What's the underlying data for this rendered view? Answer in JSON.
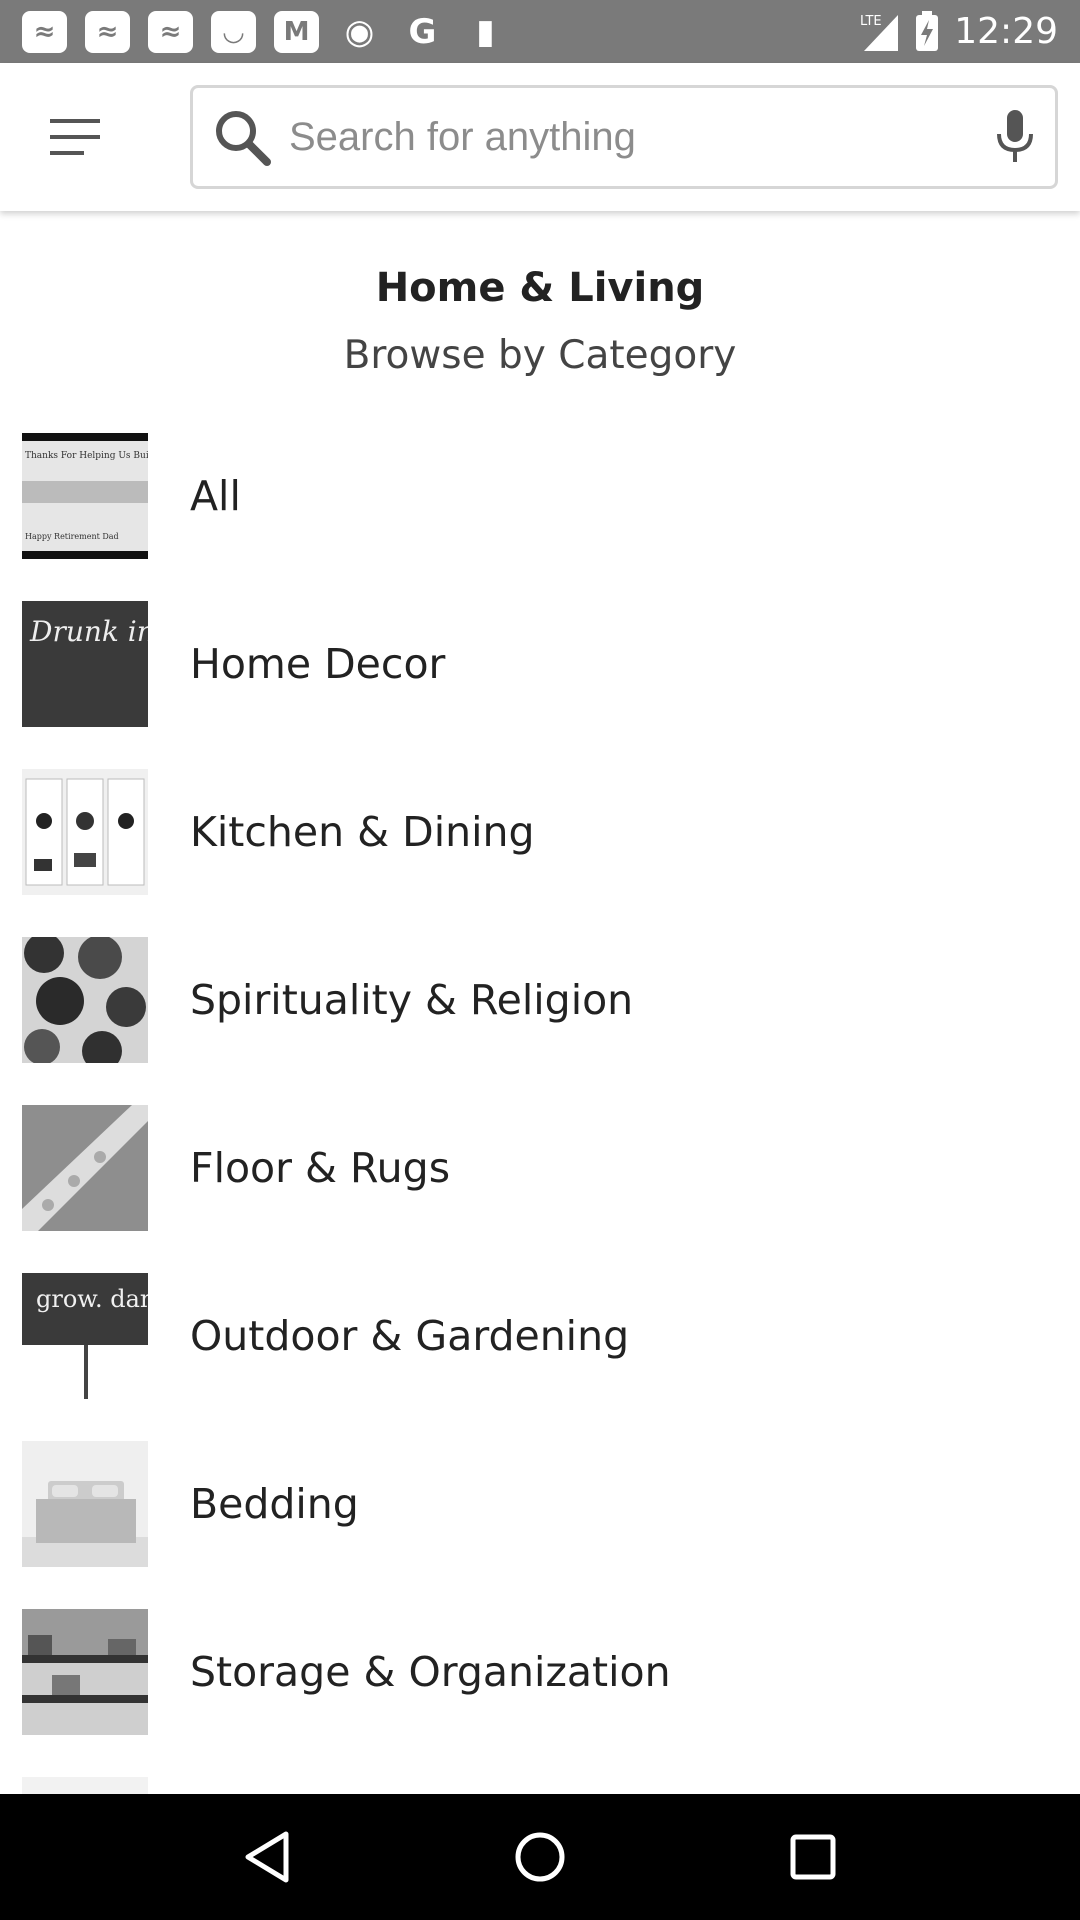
{
  "status_bar": {
    "time": "12:29",
    "network": "LTE",
    "notification_icons": [
      "news-icon",
      "news-icon",
      "news-icon",
      "smile-icon",
      "gmail-icon",
      "eye-icon",
      "google-icon",
      "sd-card-icon"
    ]
  },
  "header": {
    "menu_icon": "hamburger-menu-icon",
    "search": {
      "placeholder": "Search for anything",
      "value": "",
      "search_icon": "magnifier-icon",
      "mic_icon": "microphone-icon"
    }
  },
  "page": {
    "title": "Home & Living",
    "subtitle": "Browse by Category"
  },
  "categories": [
    {
      "label": "All"
    },
    {
      "label": "Home Decor"
    },
    {
      "label": "Kitchen & Dining"
    },
    {
      "label": "Spirituality & Religion"
    },
    {
      "label": "Floor & Rugs"
    },
    {
      "label": "Outdoor & Gardening"
    },
    {
      "label": "Bedding"
    },
    {
      "label": "Storage & Organization"
    }
  ],
  "thumbnail_texts": {
    "all": "Thanks For Helping Us Build",
    "all_bottom": "Happy Retirement Dad",
    "home_decor": "Drunk in love",
    "outdoor": "grow. dammit."
  },
  "nav_bar": {
    "back_icon": "back-triangle-icon",
    "home_icon": "home-circle-icon",
    "recents_icon": "recents-square-icon"
  },
  "colors": {
    "status_bar": "#7a7a7a",
    "nav_bar": "#000000",
    "text": "#222222",
    "placeholder": "#8c8c8c"
  }
}
